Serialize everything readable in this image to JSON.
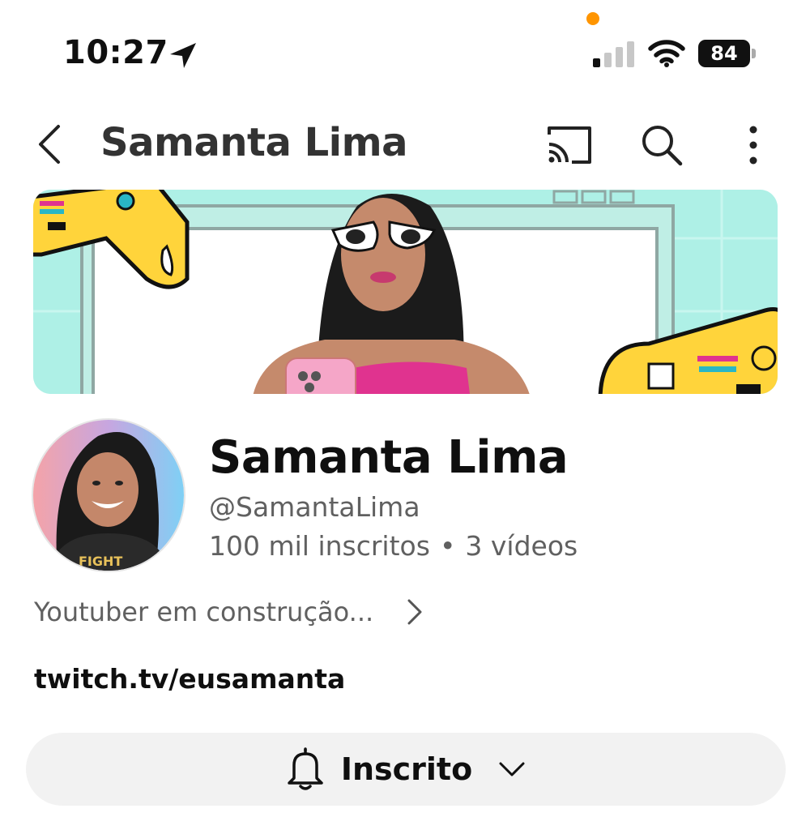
{
  "status_bar": {
    "time": "10:27",
    "battery_percent": "84",
    "location_icon": "location-arrow-icon",
    "recording_indicator_color": "#ff9500",
    "signal_bars_active": 1,
    "signal_bars_total": 4
  },
  "header": {
    "title": "Samanta Lima",
    "icons": [
      "back-chevron-icon",
      "cast-icon",
      "search-icon",
      "more-vertical-icon"
    ]
  },
  "channel": {
    "name": "Samanta Lima",
    "handle": "@SamantaLima",
    "subscribers": "100 mil inscritos",
    "separator": "•",
    "videos": "3 vídeos",
    "description": "Youtuber em construção...",
    "link": "twitch.tv/eusamanta"
  },
  "subscribe": {
    "label": "Inscrito",
    "icon": "bell-icon"
  },
  "colors": {
    "banner_bg": "#aef0e6",
    "controller_yellow": "#ffd43b",
    "accent_pink": "#e0338f",
    "secondary_text": "#606060"
  }
}
